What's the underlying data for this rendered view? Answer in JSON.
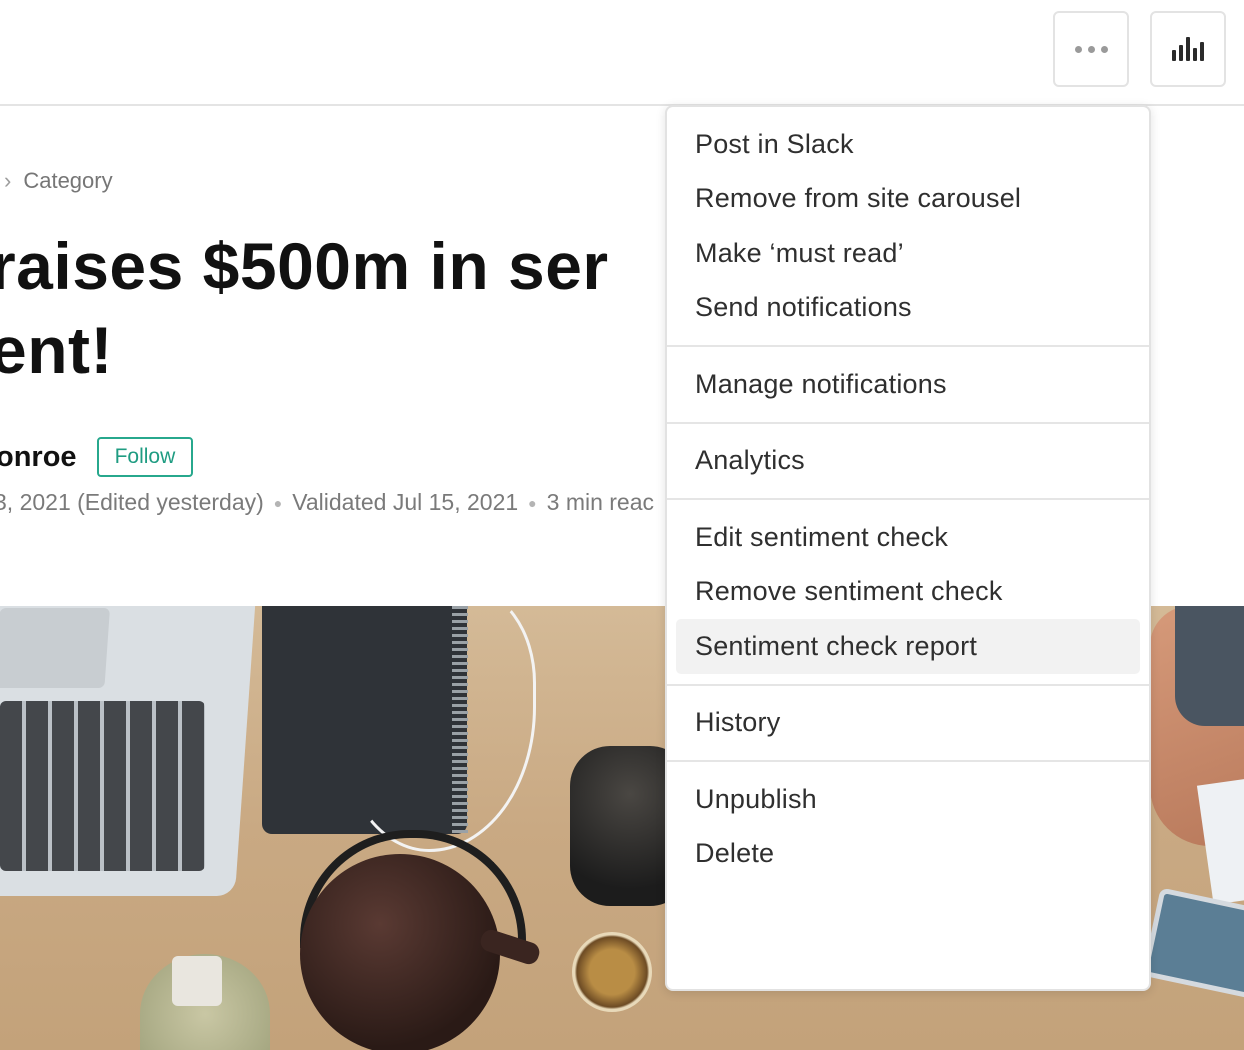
{
  "toolbar": {
    "more_icon": "more-horizontal-icon",
    "analytics_icon": "bar-chart-icon"
  },
  "article": {
    "breadcrumb_category": "Category",
    "title_line1": "raises $500m in ser",
    "title_line2": "ent!",
    "author_name": "onroe",
    "follow_label": "Follow",
    "published": "3, 2021 (Edited yesterday)",
    "validated": "Validated Jul 15, 2021",
    "read_time": "3 min reac"
  },
  "menu": {
    "groups": [
      [
        "Post in Slack",
        "Remove from site carousel",
        "Make ‘must read’",
        "Send notifications"
      ],
      [
        "Manage notifications"
      ],
      [
        "Analytics"
      ],
      [
        "Edit sentiment check",
        "Remove sentiment check",
        "Sentiment check report"
      ],
      [
        "History"
      ],
      [
        "Unpublish",
        "Delete"
      ]
    ],
    "highlighted": "Sentiment check report"
  },
  "colors": {
    "accent_follow": "#27a88d",
    "border": "#e2e2e2",
    "highlight_bg": "#f2f2f2"
  }
}
